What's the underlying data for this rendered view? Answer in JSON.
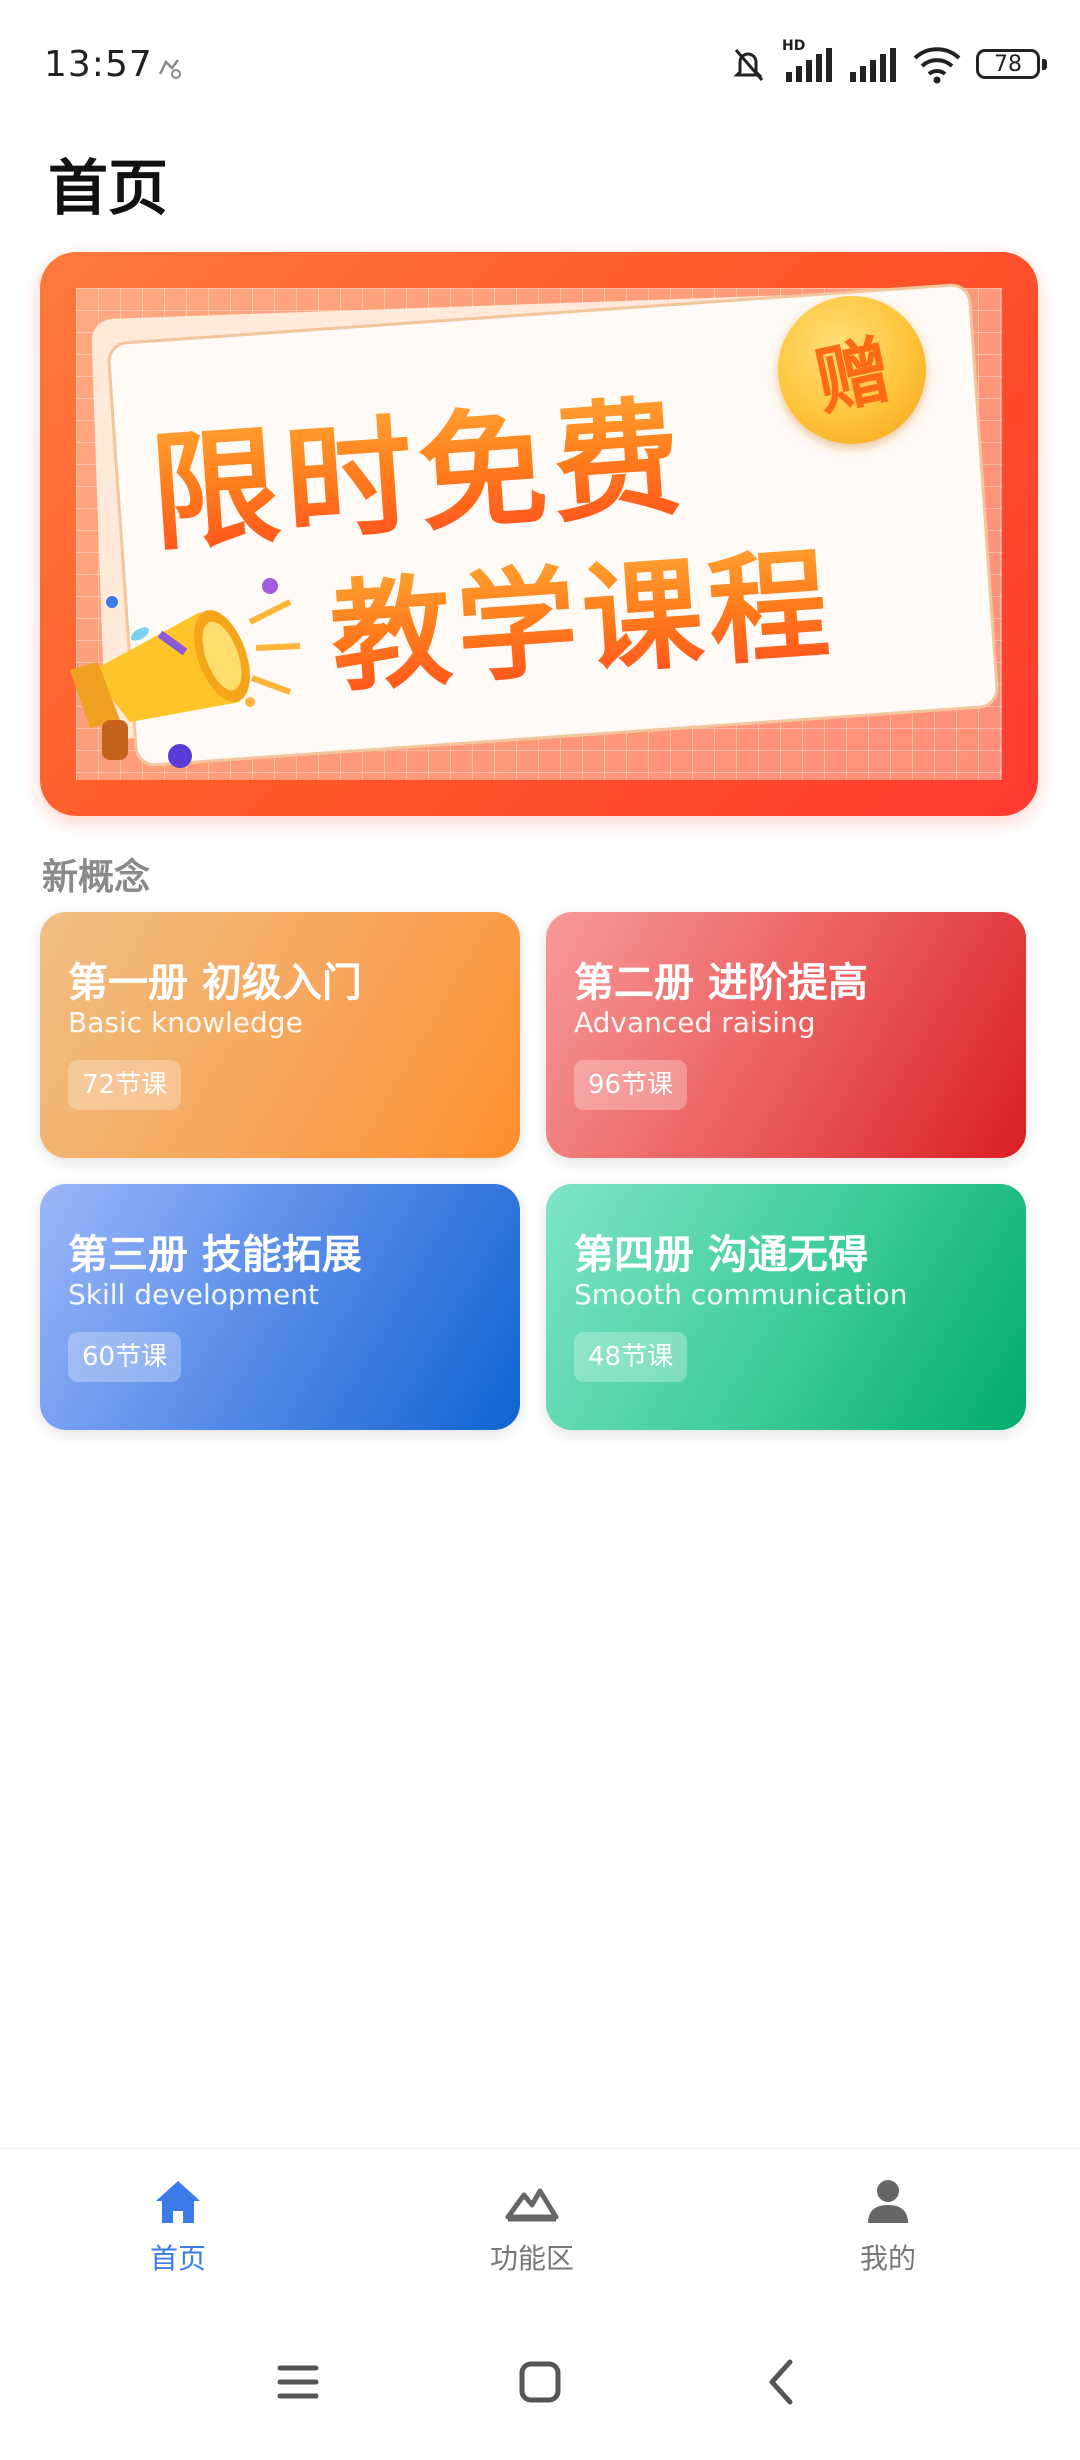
{
  "status_bar": {
    "time": "13:57",
    "battery": "78",
    "network": "HD"
  },
  "header": {
    "title": "首页"
  },
  "banner": {
    "line1": "限时免费",
    "line2": "教学课程",
    "badge": "赠"
  },
  "section": {
    "title": "新概念"
  },
  "books": [
    {
      "title": "第一册 初级入门",
      "subtitle": "Basic knowledge",
      "lessons": "72节课"
    },
    {
      "title": "第二册 进阶提高",
      "subtitle": "Advanced raising",
      "lessons": "96节课"
    },
    {
      "title": "第三册 技能拓展",
      "subtitle": "Skill development",
      "lessons": "60节课"
    },
    {
      "title": "第四册 沟通无碍",
      "subtitle": "Smooth communication",
      "lessons": "48节课"
    }
  ],
  "bottom_nav": {
    "items": [
      {
        "label": "首页",
        "icon": "home-icon",
        "active": true
      },
      {
        "label": "功能区",
        "icon": "mountain-icon",
        "active": false
      },
      {
        "label": "我的",
        "icon": "person-icon",
        "active": false
      }
    ]
  },
  "colors": {
    "accent": "#3a7be8",
    "banner": "#ff5a2a",
    "book1": "#ff8f2e",
    "book2": "#d81e24",
    "book3": "#0f63d1",
    "book4": "#00ac6a"
  }
}
